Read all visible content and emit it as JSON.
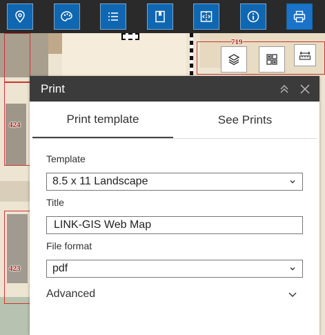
{
  "toolbar": {
    "buttons": [
      {
        "icon": "map-pin-icon"
      },
      {
        "icon": "palette-icon"
      },
      {
        "icon": "list-icon"
      },
      {
        "icon": "bookmark-icon"
      },
      {
        "icon": "compare-icon"
      },
      {
        "icon": "info-icon"
      },
      {
        "icon": "printer-icon",
        "active": true
      }
    ],
    "accent": "#0f67b1"
  },
  "map": {
    "parcels": [
      "719",
      "424",
      "423"
    ]
  },
  "map_widgets": {
    "layers": "layers-icon",
    "basemap": "basemap-grid-icon",
    "measure": "measure-icon"
  },
  "print_panel": {
    "title": "Print",
    "tabs": [
      "Print template",
      "See Prints"
    ],
    "template_label": "Template",
    "template_value": "8.5 x 11 Landscape",
    "title_label": "Title",
    "title_value": "LINK-GIS Web Map",
    "format_label": "File format",
    "format_value": "pdf",
    "advanced_label": "Advanced"
  }
}
